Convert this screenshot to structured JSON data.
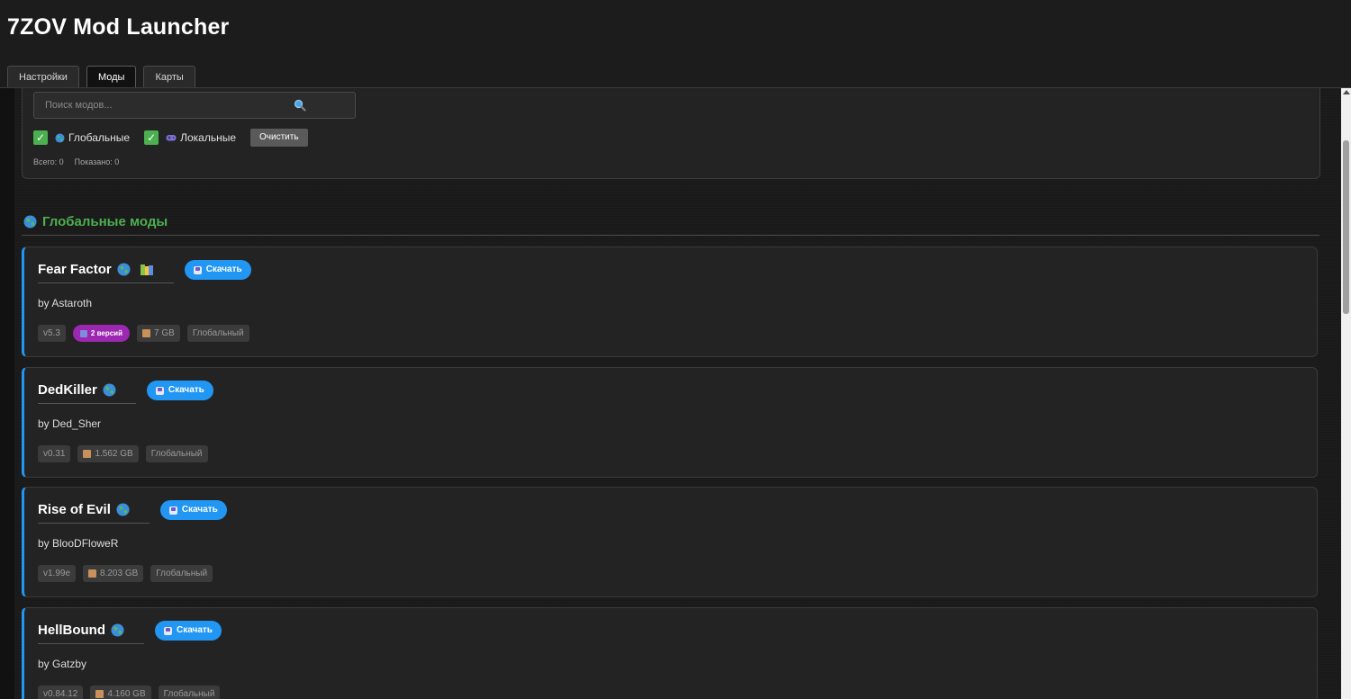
{
  "app": {
    "title": "7ZOV Mod Launcher"
  },
  "tabs": [
    {
      "label": "Настройки",
      "active": false
    },
    {
      "label": "Моды",
      "active": true
    },
    {
      "label": "Карты",
      "active": false
    }
  ],
  "filters": {
    "search_placeholder": "Поиск модов...",
    "search_value": "",
    "global_label": "Глобальные",
    "global_checked": true,
    "local_label": "Локальные",
    "local_checked": true,
    "clear_label": "Очистить",
    "checkmark": "✓",
    "total": "Всего: 0",
    "shown": "Показано: 0"
  },
  "section": {
    "title": "Глобальные моды"
  },
  "colors": {
    "accent_blue": "#2196f3",
    "section_green": "#4caf50",
    "checkbox_green": "#4caf50",
    "versions_purple": "#9c27b0"
  },
  "mods": [
    {
      "name": "Fear Factor",
      "author": "by Astaroth",
      "version": "v5.3",
      "versions_badge": "2 версий",
      "size": "7 GB",
      "scope": "Глобальный",
      "download_label": "Скачать"
    },
    {
      "name": "DedKiller",
      "author": "by Ded_Sher",
      "version": "v0.31",
      "size": "1.562 GB",
      "scope": "Глобальный",
      "download_label": "Скачать"
    },
    {
      "name": "Rise of Evil",
      "author": "by BlooDFloweR",
      "version": "v1.99e",
      "size": "8.203 GB",
      "scope": "Глобальный",
      "download_label": "Скачать"
    },
    {
      "name": "HellBound",
      "author": "by Gatzby",
      "version": "v0.84.12",
      "size": "4.160 GB",
      "scope": "Глобальный",
      "download_label": "Скачать"
    }
  ],
  "icons": [
    "search-icon",
    "globe-icon",
    "gamepad-icon",
    "books-icon",
    "download-icon",
    "box-icon"
  ]
}
